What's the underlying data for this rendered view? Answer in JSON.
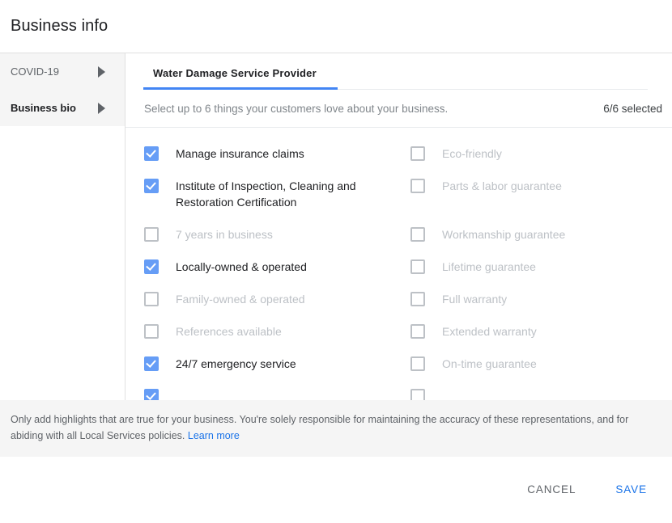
{
  "header": {
    "title": "Business info"
  },
  "sidebar": {
    "items": [
      {
        "label": "COVID-19",
        "active": false,
        "icon": "triangle-right-icon"
      },
      {
        "label": "Business bio",
        "active": true,
        "icon": "triangle-right-icon"
      }
    ]
  },
  "main": {
    "tabs": [
      {
        "label": "Water Damage Service Provider",
        "selected": true
      }
    ],
    "subtitle": "Select up to 6 things your customers love about your business.",
    "selected_count": "6/6 selected",
    "accent_color": "#4285f4",
    "checkbox_checked_color": "#669df6",
    "left_column": [
      {
        "label": "Manage insurance claims",
        "checked": true,
        "disabled": false,
        "rows": 1
      },
      {
        "label": "Institute of Inspection, Cleaning and Restoration Certification",
        "checked": true,
        "disabled": false,
        "rows": 2
      },
      {
        "label": "7 years in business",
        "checked": false,
        "disabled": true,
        "rows": 1
      },
      {
        "label": "Locally-owned & operated",
        "checked": true,
        "disabled": false,
        "rows": 1
      },
      {
        "label": "Family-owned & operated",
        "checked": false,
        "disabled": true,
        "rows": 1
      },
      {
        "label": "References available",
        "checked": false,
        "disabled": true,
        "rows": 1
      },
      {
        "label": "24/7 emergency service",
        "checked": true,
        "disabled": false,
        "rows": 1
      },
      {
        "label": "",
        "checked": true,
        "disabled": false,
        "rows": 1
      }
    ],
    "right_column": [
      {
        "label": "Eco-friendly",
        "checked": false,
        "disabled": true,
        "rows": 1
      },
      {
        "label": "Parts & labor guarantee",
        "checked": false,
        "disabled": true,
        "rows": 1
      },
      {
        "label": "Workmanship guarantee",
        "checked": false,
        "disabled": true,
        "rows": 1
      },
      {
        "label": "Lifetime guarantee",
        "checked": false,
        "disabled": true,
        "rows": 1
      },
      {
        "label": "Full warranty",
        "checked": false,
        "disabled": true,
        "rows": 1
      },
      {
        "label": "Extended warranty",
        "checked": false,
        "disabled": true,
        "rows": 1
      },
      {
        "label": "On-time guarantee",
        "checked": false,
        "disabled": true,
        "rows": 1
      },
      {
        "label": "",
        "checked": false,
        "disabled": true,
        "rows": 1
      }
    ]
  },
  "disclaimer": {
    "text": "Only add highlights that are true for your business. You're solely responsible for maintaining the accuracy of these representations, and for abiding with all Local Services policies.",
    "link_label": "Learn more"
  },
  "footer": {
    "cancel_label": "CANCEL",
    "save_label": "SAVE"
  }
}
